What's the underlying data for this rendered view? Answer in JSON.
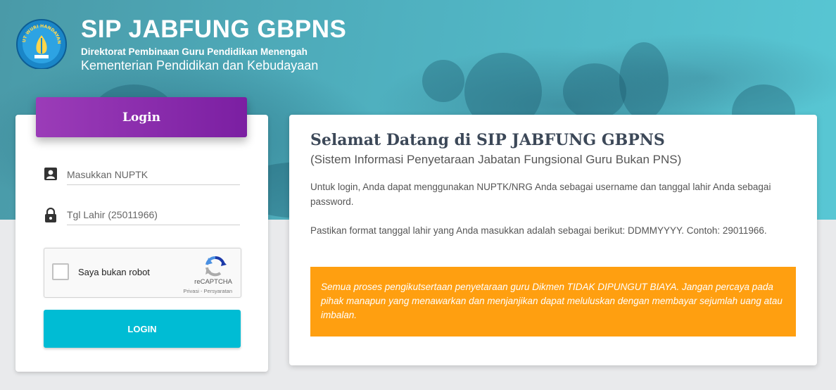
{
  "header": {
    "title": "SIP JABFUNG GBPNS",
    "subtitle1": "Direktorat Pembinaan Guru Pendidikan Menengah",
    "subtitle2": "Kementerian Pendidikan dan Kebudayaan",
    "logo_text": "TUT WURI HANDAYANI",
    "logo_icon": "ministry-emblem-icon"
  },
  "login": {
    "header_label": "Login",
    "nuptk_placeholder": "Masukkan NUPTK",
    "dob_placeholder": "Tgl Lahir (25011966)",
    "captcha_label": "Saya bukan robot",
    "captcha_brand": "reCAPTCHA",
    "captcha_terms": "Privasi - Persyaratan",
    "button_label": "LOGIN",
    "icons": {
      "user": "account-box-icon",
      "lock": "lock-icon",
      "recaptcha": "recaptcha-logo-icon"
    }
  },
  "info": {
    "title": "Selamat Datang di SIP JABFUNG GBPNS",
    "subtitle": "(Sistem Informasi Penyetaraan Jabatan Fungsional Guru Bukan PNS)",
    "paragraph1": "Untuk login, Anda dapat menggunakan NUPTK/NRG Anda sebagai username dan tanggal lahir Anda sebagai password.",
    "paragraph2": "Pastikan format tanggal lahir yang Anda masukkan adalah sebagai berikut: DDMMYYYY. Contoh: 29011966.",
    "warning": "Semua proses pengikutsertaan penyetaraan guru Dikmen TIDAK DIPUNGUT BIAYA. Jangan percaya pada pihak manapun yang menawarkan dan menjanjikan dapat meluluskan dengan membayar sejumlah uang atau imbalan."
  },
  "colors": {
    "hero": "#4fb0bf",
    "login_header": "#8e24aa",
    "login_button": "#00bcd4",
    "warning": "#ff9f10"
  }
}
